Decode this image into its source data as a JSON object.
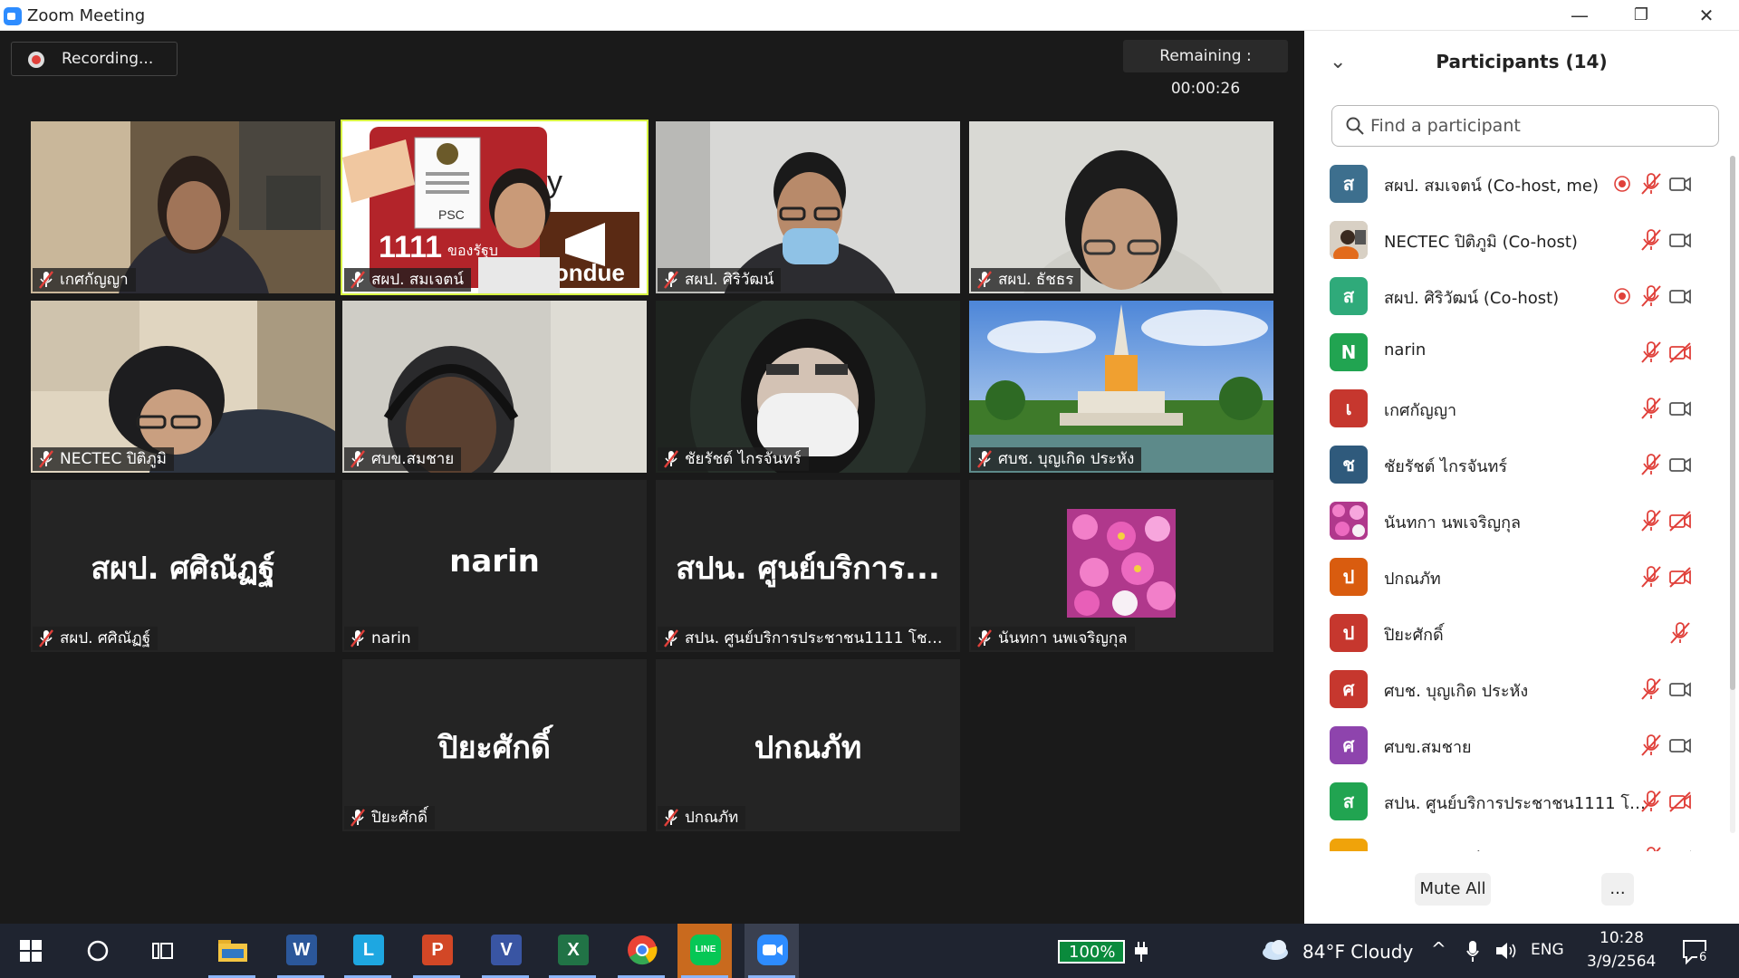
{
  "window": {
    "title": "Zoom Meeting",
    "minimize": "—",
    "restore": "❐",
    "close": "✕"
  },
  "meeting": {
    "recording": "Recording...",
    "remaining": "Remaining : 00:00:26"
  },
  "tiles": [
    {
      "name": "เกศกัญญา",
      "type": "video"
    },
    {
      "name": "สผป. สมเจตน์",
      "type": "video",
      "active": true
    },
    {
      "name": "สผป. ศิริวัฒน์",
      "type": "video"
    },
    {
      "name": "สผป. ธัชธร",
      "type": "video"
    },
    {
      "name": "NECTEC ปิติภูมิ",
      "type": "video"
    },
    {
      "name": "ศบข.สมชาย",
      "type": "video"
    },
    {
      "name": "ชัยรัชต์ ไกรจันทร์",
      "type": "video"
    },
    {
      "name": "ศบช. บุญเกิด ประหัง",
      "type": "video"
    },
    {
      "name": "สผป. ศศิณัฏฐ์",
      "big": "สผป. ศศิณัฏฐ์",
      "type": "name"
    },
    {
      "name": "narin",
      "big": "narin",
      "type": "name"
    },
    {
      "name": "สปน. ศูนย์บริการประชาชน1111 โชคชัย...",
      "big": "สปน. ศูนย์บริการ...",
      "type": "name"
    },
    {
      "name": "นันทกา นพเจริญกุล",
      "type": "photo"
    },
    {
      "name": "ปิยะศักดิ์",
      "big": "ปิยะศักดิ์",
      "type": "name"
    },
    {
      "name": "ปกณภัท",
      "big": "ปกณภัท",
      "type": "name"
    }
  ],
  "poster": {
    "number": "1111",
    "brand": "PSC",
    "subtitle": "ของรัฐบ",
    "tag": "Fondue",
    "by": "y"
  },
  "participants_panel": {
    "title": "Participants (14)",
    "search_placeholder": "Find a participant",
    "mute_all": "Mute All",
    "more": "...",
    "participants": [
      {
        "name": "สผป. สมเจตน์ (Co-host, me)",
        "initial": "ส",
        "color": "#3d6f8e",
        "recording": true,
        "video": true
      },
      {
        "name": "NECTEC ปิติภูมิ (Co-host)",
        "initial": "",
        "color": "#c8bfb2",
        "recording": false,
        "video": true,
        "photo": true
      },
      {
        "name": "สผป. ศิริวัฒน์ (Co-host)",
        "initial": "ส",
        "color": "#2faa7a",
        "recording": true,
        "video": true
      },
      {
        "name": "narin",
        "initial": "N",
        "color": "#21a451",
        "recording": false,
        "video": false
      },
      {
        "name": "เกศกัญญา",
        "initial": "เ",
        "color": "#c6372e",
        "recording": false,
        "video": true
      },
      {
        "name": "ชัยรัชต์ ไกรจันทร์",
        "initial": "ช",
        "color": "#2f5a7c",
        "recording": false,
        "video": true
      },
      {
        "name": "นันทกา นพเจริญกุล",
        "initial": "",
        "color": "#d45dbb",
        "recording": false,
        "video": false,
        "photo": true
      },
      {
        "name": "ปกณภัท",
        "initial": "ป",
        "color": "#d95c0f",
        "recording": false,
        "video": false
      },
      {
        "name": "ปิยะศักดิ์",
        "initial": "ป",
        "color": "#c6372e",
        "recording": false,
        "video": null
      },
      {
        "name": "ศบช. บุญเกิด ประหัง",
        "initial": "ศ",
        "color": "#c6372e",
        "recording": false,
        "video": true
      },
      {
        "name": "ศบข.สมชาย",
        "initial": "ศ",
        "color": "#8e44ad",
        "recording": false,
        "video": true
      },
      {
        "name": "สปน. ศูนย์บริการประชาชน1111 โชค...",
        "initial": "ส",
        "color": "#21a451",
        "recording": false,
        "video": false
      },
      {
        "name": "สผป. ศศิณัฏฐ์",
        "initial": "ส",
        "color": "#f0a30a",
        "recording": false,
        "video": true
      }
    ]
  },
  "taskbar": {
    "apps": [
      {
        "name": "file-explorer",
        "label": "",
        "color": "#f4c542"
      },
      {
        "name": "word",
        "label": "W",
        "color": "#2b579a"
      },
      {
        "name": "app-l",
        "label": "L",
        "color": "#1ea7e1"
      },
      {
        "name": "powerpoint",
        "label": "P",
        "color": "#d24726"
      },
      {
        "name": "visio",
        "label": "V",
        "color": "#3955a3"
      },
      {
        "name": "excel",
        "label": "X",
        "color": "#217346"
      },
      {
        "name": "chrome",
        "label": "",
        "color": "#ea4335"
      },
      {
        "name": "line",
        "label": "LINE",
        "color": "#06c755"
      },
      {
        "name": "zoom",
        "label": "",
        "color": "#2d8cff"
      }
    ],
    "battery": "100%",
    "weather": "84°F  Cloudy",
    "lang": "ENG",
    "time": "10:28",
    "date": "3/9/2564",
    "notifications": "6"
  }
}
